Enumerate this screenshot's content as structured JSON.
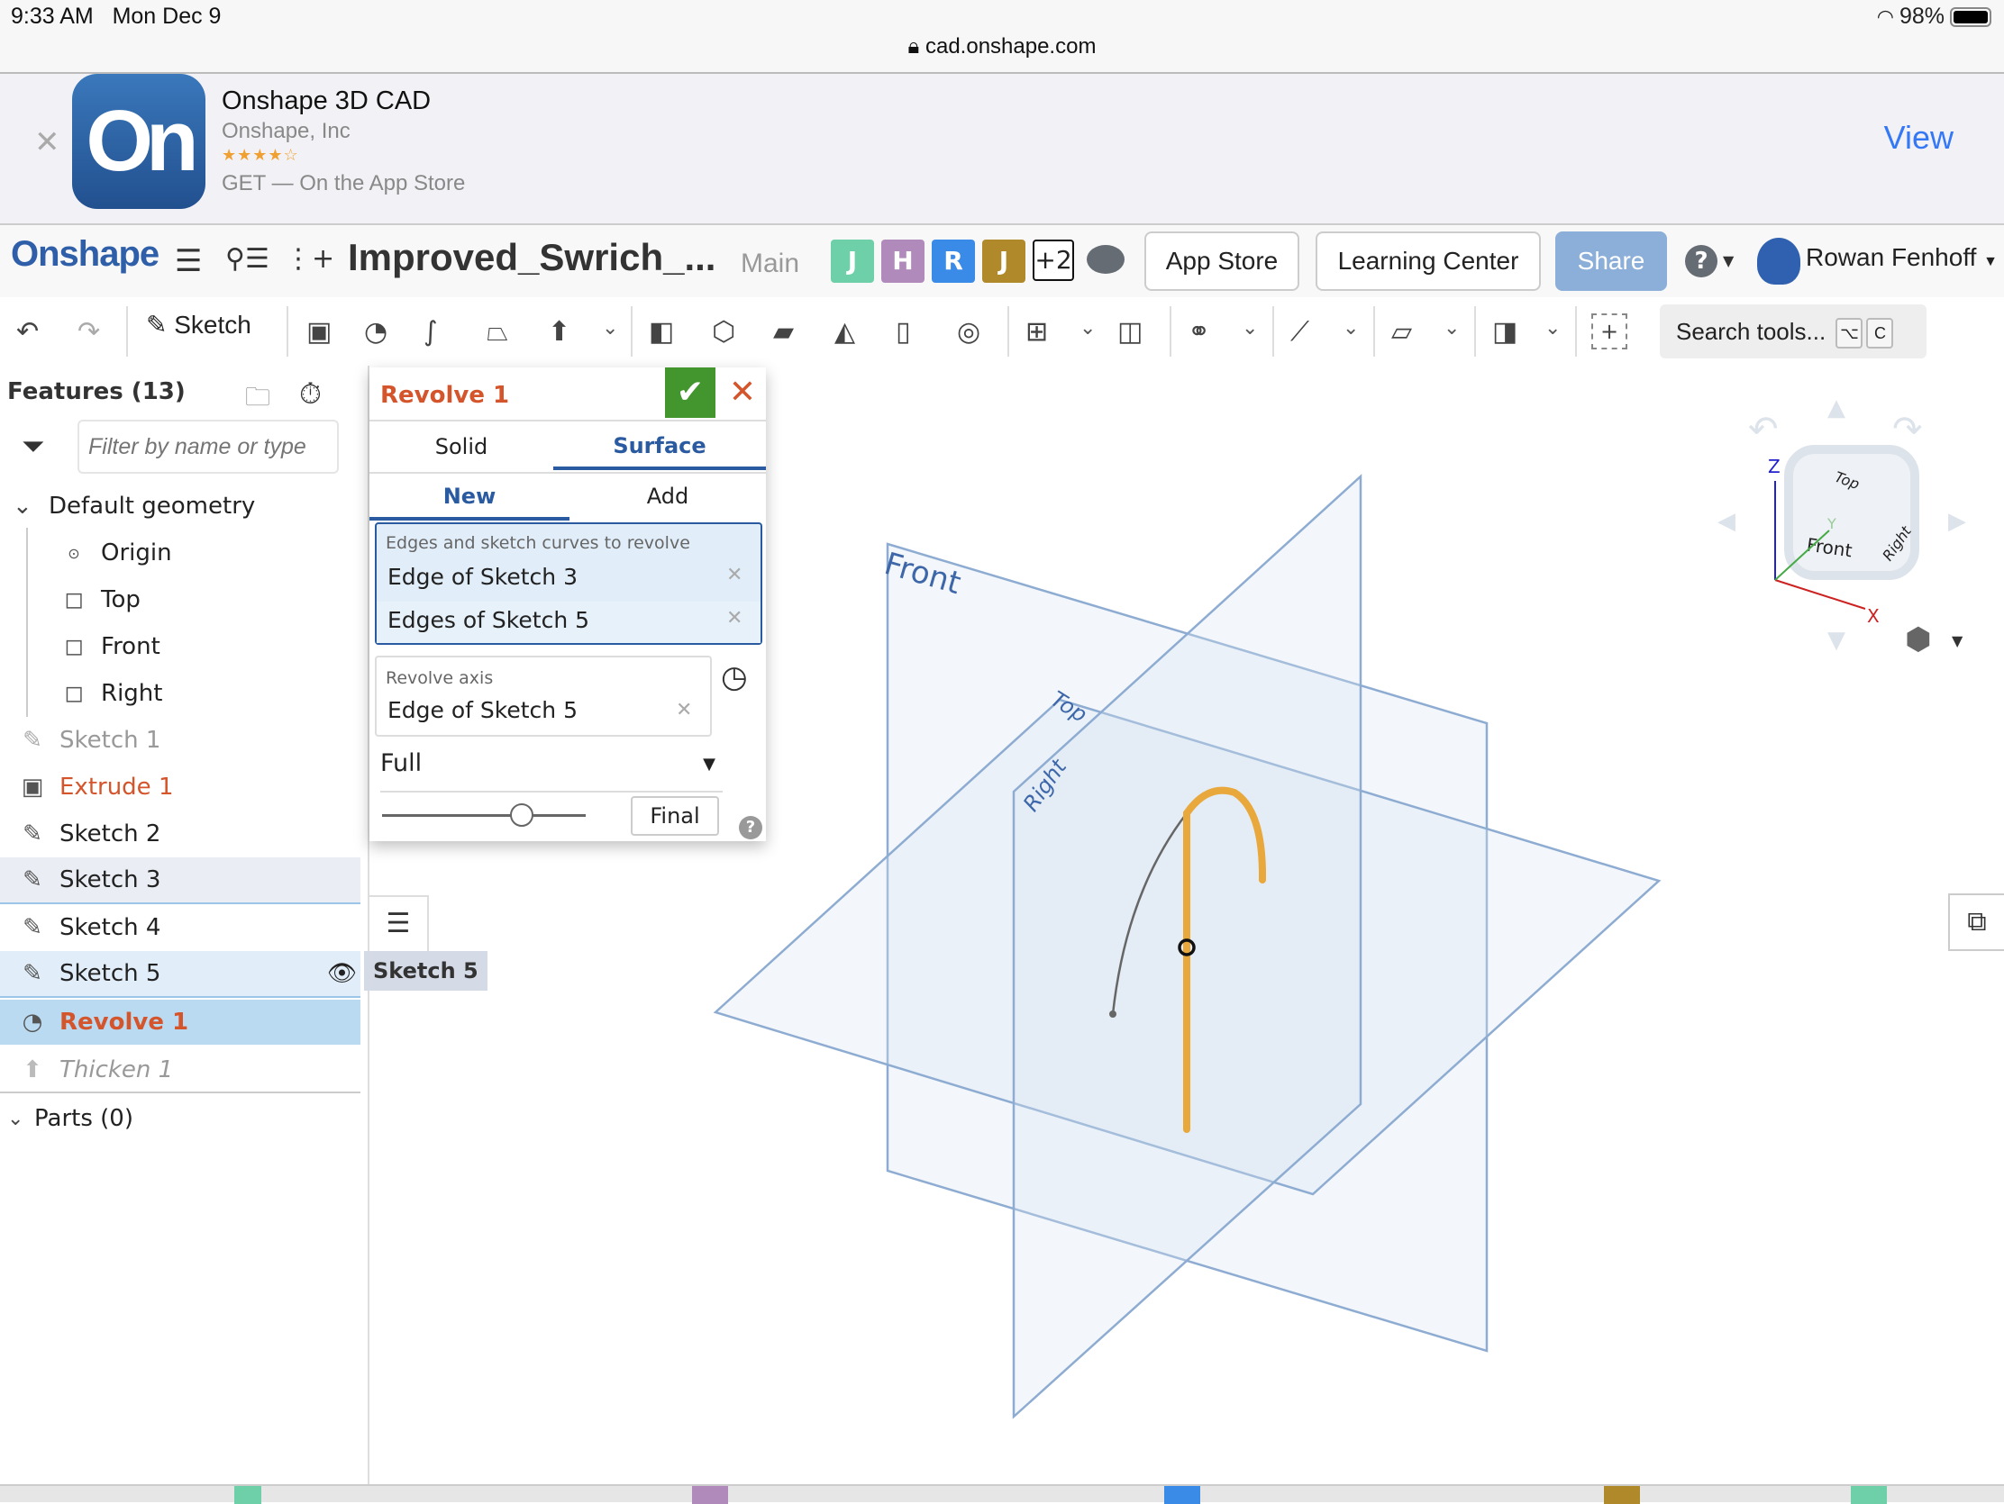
{
  "status_bar": {
    "time": "9:33 AM",
    "date": "Mon Dec 9",
    "battery": "98%",
    "url": "cad.onshape.com"
  },
  "app_banner": {
    "title": "Onshape 3D CAD",
    "company": "Onshape, Inc",
    "rating": "★★★★☆",
    "rating_value": 3.5,
    "cta": "GET — On the App Store",
    "view_label": "View",
    "icon_text": "On"
  },
  "header": {
    "logo": "Onshape",
    "doc_title": "Improved_Swrich_...",
    "branch": "Main",
    "collaborators": [
      {
        "initial": "J",
        "color": "#6dd0a8"
      },
      {
        "initial": "H",
        "color": "#b08abb"
      },
      {
        "initial": "R",
        "color": "#3a8be8"
      },
      {
        "initial": "J",
        "color": "#b08a2a"
      }
    ],
    "more_collaborators": "+2",
    "app_store_label": "App Store",
    "learning_center_label": "Learning Center",
    "share_label": "Share",
    "help_label": "?",
    "user_name": "Rowan Fenhoff"
  },
  "toolbar": {
    "sketch_label": "Sketch",
    "search_placeholder": "Search tools...",
    "search_keys": [
      "⌥",
      "C"
    ]
  },
  "feature_panel": {
    "title": "Features (13)",
    "filter_placeholder": "Filter by name or type",
    "default_geometry_label": "Default geometry",
    "default_items": [
      "Origin",
      "Top",
      "Front",
      "Right"
    ],
    "features": [
      {
        "label": "Sketch 1",
        "state": "suppressed"
      },
      {
        "label": "Extrude 1",
        "state": "error"
      },
      {
        "label": "Sketch 2",
        "state": "normal"
      },
      {
        "label": "Sketch 3",
        "state": "hover"
      },
      {
        "label": "Sketch 4",
        "state": "normal"
      },
      {
        "label": "Sketch 5",
        "state": "selected"
      },
      {
        "label": "Revolve 1",
        "state": "editing"
      },
      {
        "label": "Thicken 1",
        "state": "rolled-back"
      }
    ],
    "parts_label": "Parts (0)",
    "tooltip": "Sketch 5"
  },
  "revolve_dialog": {
    "title": "Revolve 1",
    "type_tabs": [
      "Solid",
      "Surface"
    ],
    "active_type": "Surface",
    "op_tabs": [
      "New",
      "Add"
    ],
    "active_op": "New",
    "edges_label": "Edges and sketch curves to revolve",
    "edges": [
      "Edge of Sketch 3",
      "Edges of Sketch 5"
    ],
    "axis_label": "Revolve axis",
    "axis_value": "Edge of Sketch 5",
    "revolve_type": "Full",
    "slider_value": 0.7,
    "final_label": "Final"
  },
  "viewport": {
    "planes": [
      "Front",
      "Top",
      "Right"
    ],
    "view_cube": {
      "faces": [
        "Top",
        "Front",
        "Right"
      ],
      "axes": [
        "X",
        "Y",
        "Z"
      ]
    }
  }
}
